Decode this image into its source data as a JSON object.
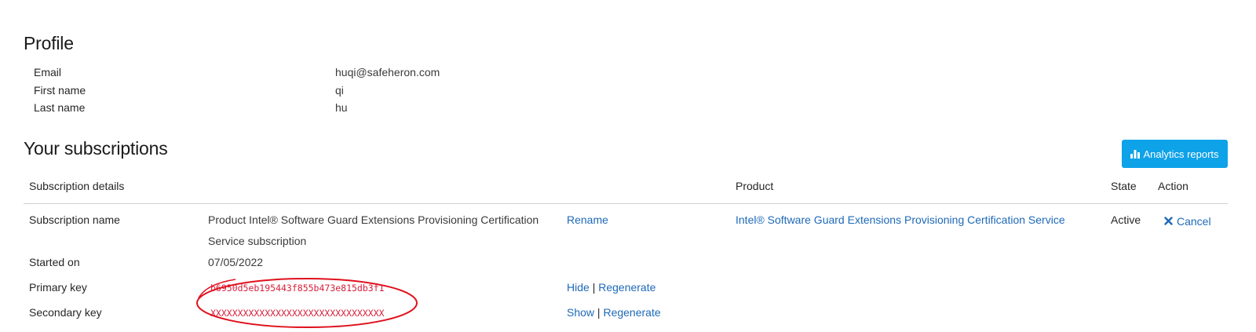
{
  "profile": {
    "title": "Profile",
    "fields": [
      {
        "label": "Email",
        "value": "huqi@safeheron.com"
      },
      {
        "label": "First name",
        "value": "qi"
      },
      {
        "label": "Last name",
        "value": "hu"
      }
    ]
  },
  "subscriptions": {
    "title": "Your subscriptions",
    "analytics_button": "Analytics reports",
    "analytics_icon": "bar-chart-icon",
    "columns": {
      "details": "Subscription details",
      "product": "Product",
      "state": "State",
      "action": "Action"
    },
    "row": {
      "name_label": "Subscription name",
      "name_line1": "Product Intel® Software Guard Extensions Provisioning Certification",
      "name_line2": "Service subscription",
      "rename_link": "Rename",
      "product_link": "Intel® Software Guard Extensions Provisioning Certification Service",
      "state": "Active",
      "cancel_label": "Cancel",
      "cancel_icon": "close-icon",
      "started_label": "Started on",
      "started_value": "07/05/2022",
      "primary_key_label": "Primary key",
      "primary_key_value": "b6950d5eb195443f855b473e815db3f1",
      "primary_hide": "Hide",
      "primary_regenerate": "Regenerate",
      "secondary_key_label": "Secondary key",
      "secondary_key_value": "XXXXXXXXXXXXXXXXXXXXXXXXXXXXXXXX",
      "secondary_show": "Show",
      "secondary_regenerate": "Regenerate",
      "separator": "|"
    }
  },
  "colors": {
    "accent": "#0ea2e8",
    "link": "#1e69b8",
    "key_text": "#d61f3a",
    "annotation": "#e0101c"
  }
}
